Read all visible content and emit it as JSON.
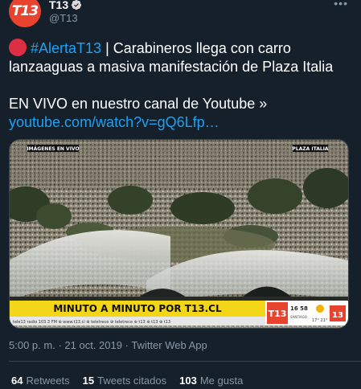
{
  "account": {
    "name": "T13",
    "handle": "@T13",
    "avatar_text": "T13"
  },
  "tweet": {
    "hashtag": "#AlertaT13",
    "text_line1": " | Carabineros llega con carro lanzaaguas a masiva manifestación de Plaza Italia",
    "text_line2": "EN VIVO en nuestro canal de Youtube »",
    "link": "youtube.com/watch?v=gQ6Lfp…"
  },
  "media": {
    "label_left": "IMÁGENES EN VIVO",
    "label_right": "PLAZA ITALIA",
    "banner": "MINUTO A MINUTO POR T13.CL",
    "ticker": "tele13 radio 103.3 FM   ⊕ www.t13.cl   ⊕ teletrece   ⊕ teletrece   ⊕ t13   ⊕ t13   ⊕ t13",
    "logo": "T13",
    "time": "16 58",
    "city": "SANTIAGO",
    "temps": "17°  21°",
    "channel_logo": "13"
  },
  "meta": {
    "time": "5:00 p. m.",
    "sep1": "·",
    "date": "21 oct. 2019",
    "sep2": "·",
    "client": "Twitter Web App"
  },
  "stats": {
    "retweets_count": "64",
    "retweets_label": "Retweets",
    "quotes_count": "15",
    "quotes_label": "Tweets citados",
    "likes_count": "103",
    "likes_label": "Me gusta"
  },
  "colors": {
    "background": "#15202b",
    "link": "#1da1f2",
    "muted": "#8899a6",
    "brand_red": "#e8432f",
    "banner_yellow": "#f4d619"
  },
  "icons": {
    "verified": "verified-badge-icon",
    "more": "more-dots-icon",
    "emoji": "red-circle-emoji"
  }
}
